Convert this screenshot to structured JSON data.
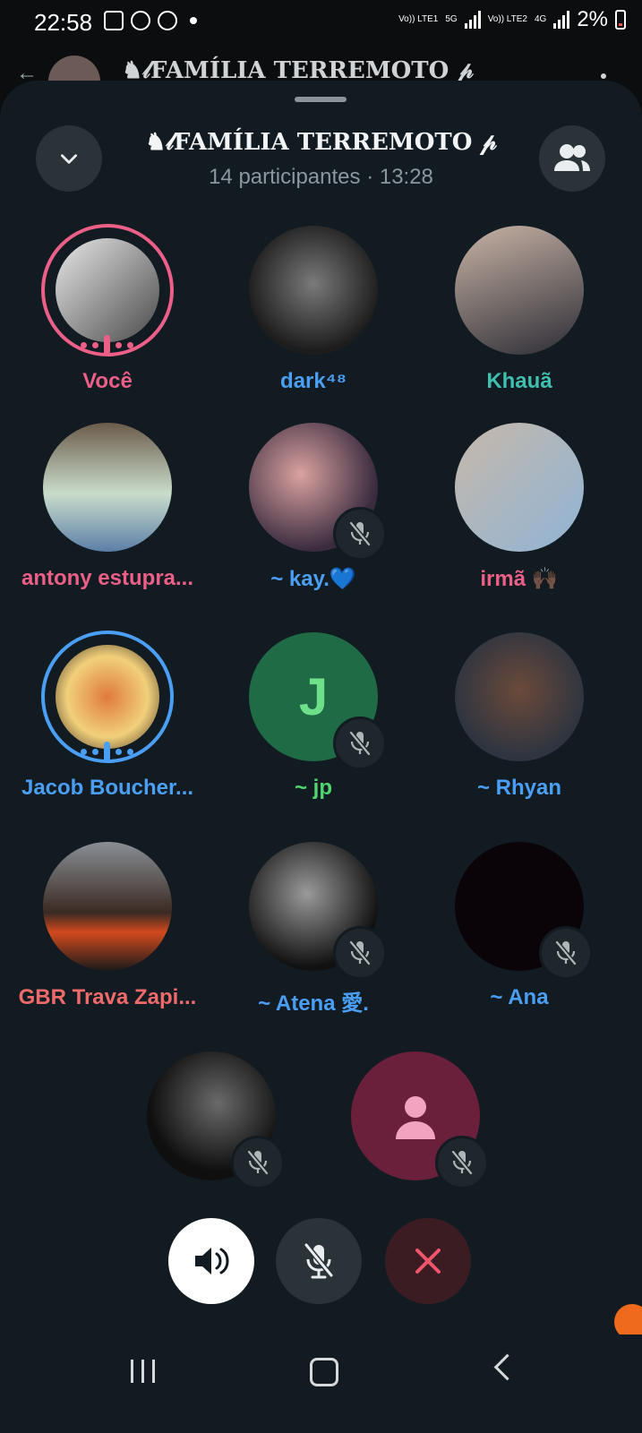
{
  "status_bar": {
    "time": "22:58",
    "network_1": "Vo)) LTE1",
    "network_1_type": "5G",
    "network_2": "Vo)) LTE2",
    "network_2_type": "4G",
    "battery": "2%"
  },
  "background_chat": {
    "title": "♞𝓁FAMÍLIA TERREMOTO 𝓅"
  },
  "call": {
    "title": "♞𝓁FAMÍLIA TERREMOTO 𝓅",
    "subtitle": "14 participantes · 13:28"
  },
  "participants": [
    {
      "name": "Você",
      "color": "#ec5f87",
      "speaking": "pink",
      "muted": false,
      "avatar": "photo"
    },
    {
      "name": "dark⁴⁸",
      "color": "#4a9ff5",
      "muted": false,
      "avatar": "photo"
    },
    {
      "name": "Khauã",
      "color": "#3fbfb0",
      "muted": false,
      "avatar": "photo"
    },
    {
      "name": "antony estupra...",
      "color": "#ec5f87",
      "muted": false,
      "avatar": "photo"
    },
    {
      "name": "~ kay.💙",
      "color": "#4a9ff5",
      "muted": true,
      "avatar": "photo"
    },
    {
      "name": "irmã 🙌🏿",
      "color": "#ec5f87",
      "muted": false,
      "avatar": "photo"
    },
    {
      "name": "Jacob Boucher...",
      "color": "#4a9ff5",
      "speaking": "blue",
      "muted": false,
      "avatar": "photo"
    },
    {
      "name": "~ jp",
      "color": "#4fd66f",
      "muted": true,
      "avatar": "letter",
      "letter": "J"
    },
    {
      "name": "~ Rhyan",
      "color": "#4a9ff5",
      "muted": false,
      "avatar": "photo"
    },
    {
      "name": "GBR Trava Zapi...",
      "color": "#ef6a6a",
      "muted": false,
      "avatar": "photo"
    },
    {
      "name": "~ Atena 愛.",
      "color": "#4a9ff5",
      "muted": true,
      "avatar": "photo"
    },
    {
      "name": "~ Ana",
      "color": "#4a9ff5",
      "muted": true,
      "avatar": "dark"
    },
    {
      "name": "",
      "color": "#4a9ff5",
      "muted": true,
      "avatar": "photo"
    },
    {
      "name": "",
      "color": "#4a9ff5",
      "muted": true,
      "avatar": "placeholder"
    }
  ],
  "controls": {
    "speaker": "speaker-icon",
    "mic": "mic-off-icon",
    "end": "close-icon"
  }
}
